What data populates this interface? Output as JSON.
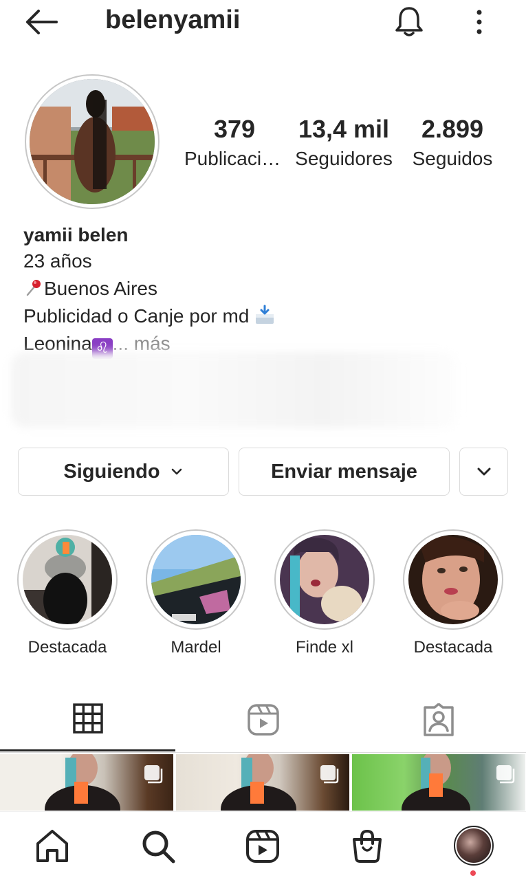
{
  "header": {
    "username": "belenyamii"
  },
  "stats": {
    "posts": {
      "value": "379",
      "label": "Publicaciones"
    },
    "followers": {
      "value": "13,4 mil",
      "label": "Seguidores"
    },
    "following": {
      "value": "2.899",
      "label": "Seguidos"
    }
  },
  "bio": {
    "name": "yamii belen",
    "age": "23 años",
    "location": "Buenos Aires",
    "ads": "Publicidad o Canje por md",
    "sign": "Leonina",
    "more": "... más"
  },
  "actions": {
    "following_label": "Siguiendo",
    "message_label": "Enviar mensaje"
  },
  "highlights": [
    {
      "label": "Destacada"
    },
    {
      "label": "Mardel"
    },
    {
      "label": "Finde xl"
    },
    {
      "label": "Destacada"
    }
  ],
  "tabs": {
    "grid": "grid-icon",
    "reels": "reels-icon",
    "tagged": "tagged-icon"
  },
  "bottom_nav": [
    "home-icon",
    "search-icon",
    "reels-icon",
    "shop-icon",
    "profile-avatar"
  ],
  "colors": {
    "text": "#262626",
    "muted": "#8e8e8e",
    "border": "#dbdbdb",
    "notification_dot": "#ed4956"
  }
}
